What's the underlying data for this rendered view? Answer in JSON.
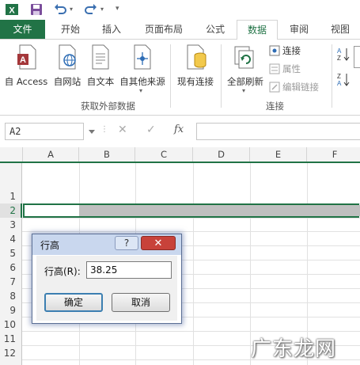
{
  "quick_access": {
    "app_icon": "excel-logo-icon",
    "save_icon": "save-icon",
    "undo_icon": "undo-icon",
    "redo_icon": "redo-icon",
    "customize_icon": "customize-toolbar-icon"
  },
  "tabs": [
    "文件",
    "开始",
    "插入",
    "页面布局",
    "公式",
    "数据",
    "审阅",
    "视图"
  ],
  "active_tab": "数据",
  "ribbon": {
    "get_external": {
      "buttons": [
        "自 Access",
        "自网站",
        "自文本",
        "自其他来源"
      ],
      "label": "获取外部数据"
    },
    "existing_connections": "现有连接",
    "connections": {
      "refresh_all": "全部刷新",
      "items": [
        "连接",
        "属性",
        "编辑链接"
      ],
      "label": "连接"
    }
  },
  "formula_bar": {
    "name_box": "A2",
    "cancel_symbol": "✕",
    "enter_symbol": "✓",
    "fx_symbol": "fx"
  },
  "grid": {
    "columns": [
      "A",
      "B",
      "C",
      "D",
      "E",
      "F"
    ],
    "rows": [
      "1",
      "2",
      "3",
      "4",
      "5",
      "6",
      "7",
      "8",
      "9",
      "10",
      "11",
      "12"
    ],
    "selected_row": "2"
  },
  "dialog": {
    "title": "行高",
    "help": "?",
    "close": "✕",
    "label": "行高(R):",
    "value": "38.25",
    "ok": "确定",
    "cancel": "取消"
  },
  "watermark": "广东龙网",
  "colors": {
    "accent_green": "#217346",
    "dialog_title_bg": "#c9d7ee",
    "close_red": "#c8423a",
    "selection_gray": "#bfbfbf"
  }
}
